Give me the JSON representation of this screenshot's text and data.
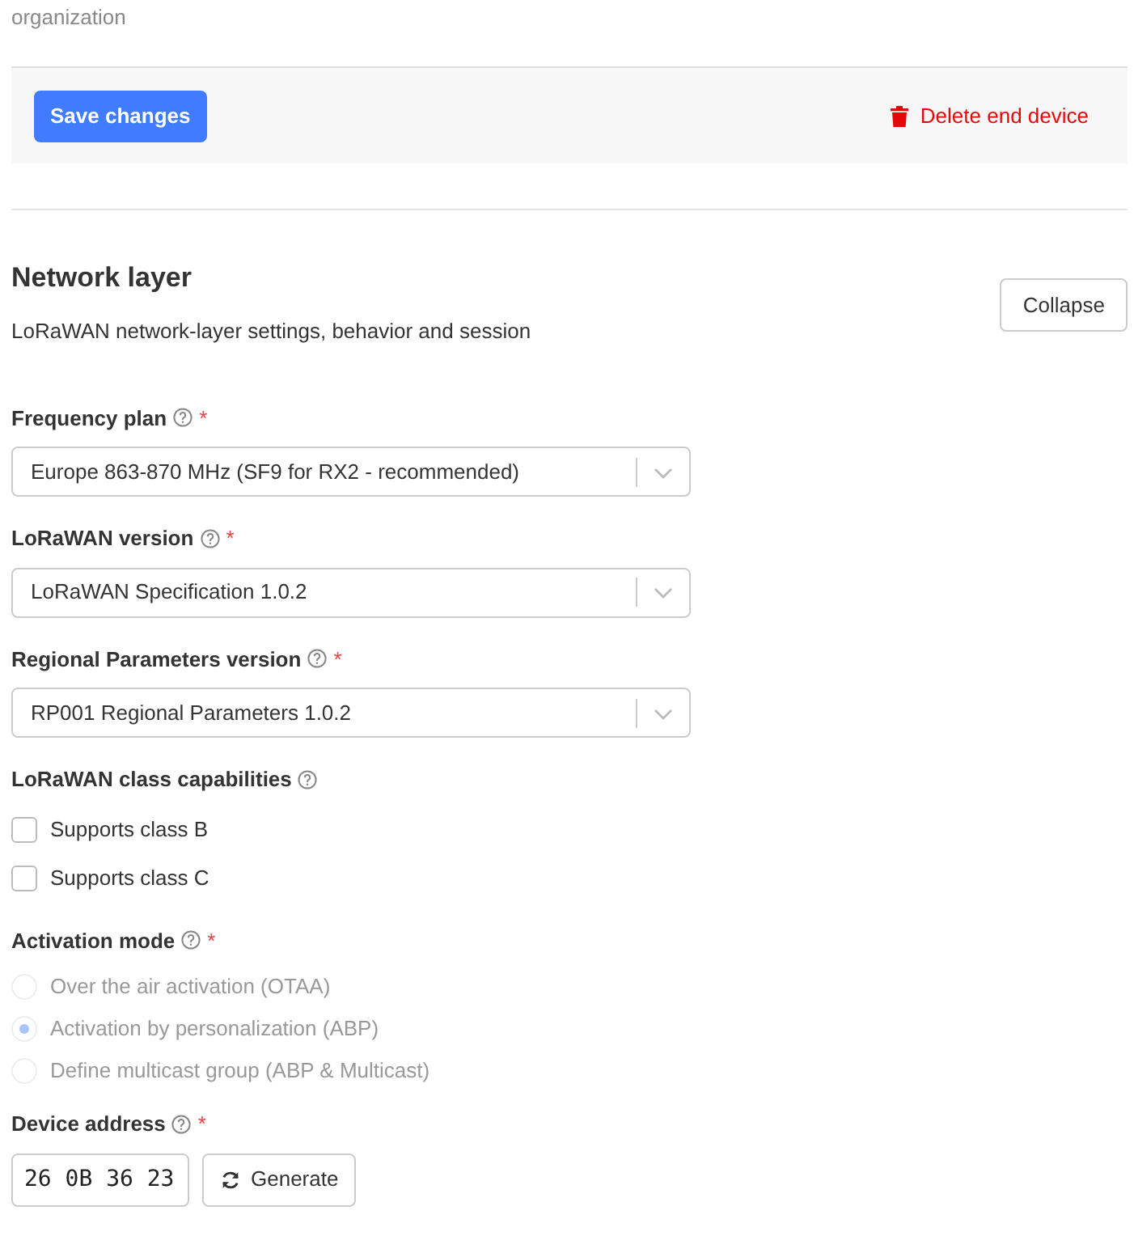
{
  "top_text": "organization",
  "actions": {
    "save": "Save changes",
    "delete": "Delete end device"
  },
  "section": {
    "title": "Network layer",
    "description": "LoRaWAN network-layer settings, behavior and session",
    "collapse": "Collapse"
  },
  "fields": [
    {
      "kind": "select",
      "label": "Frequency plan",
      "required_mark": "*",
      "value": "Europe 863-870 MHz (SF9 for RX2 - recommended)"
    },
    {
      "kind": "select",
      "label": "LoRaWAN version",
      "required_mark": "*",
      "value": "LoRaWAN Specification 1.0.2"
    },
    {
      "kind": "select",
      "label": "Regional Parameters version",
      "required_mark": "*",
      "value": "RP001 Regional Parameters 1.0.2"
    },
    {
      "kind": "checkboxes",
      "label": "LoRaWAN class capabilities",
      "options": [
        {
          "label": "Supports class B",
          "checked": false
        },
        {
          "label": "Supports class C",
          "checked": false
        }
      ]
    },
    {
      "kind": "radios",
      "label": "Activation mode",
      "required_mark": "*",
      "disabled": true,
      "options": [
        {
          "label": "Over the air activation (OTAA)",
          "selected": false
        },
        {
          "label": "Activation by personalization (ABP)",
          "selected": true
        },
        {
          "label": "Define multicast group (ABP & Multicast)",
          "selected": false
        }
      ]
    },
    {
      "kind": "address",
      "label": "Device address",
      "required_mark": "*",
      "value": "26 0B 36 23",
      "button": "Generate"
    }
  ]
}
